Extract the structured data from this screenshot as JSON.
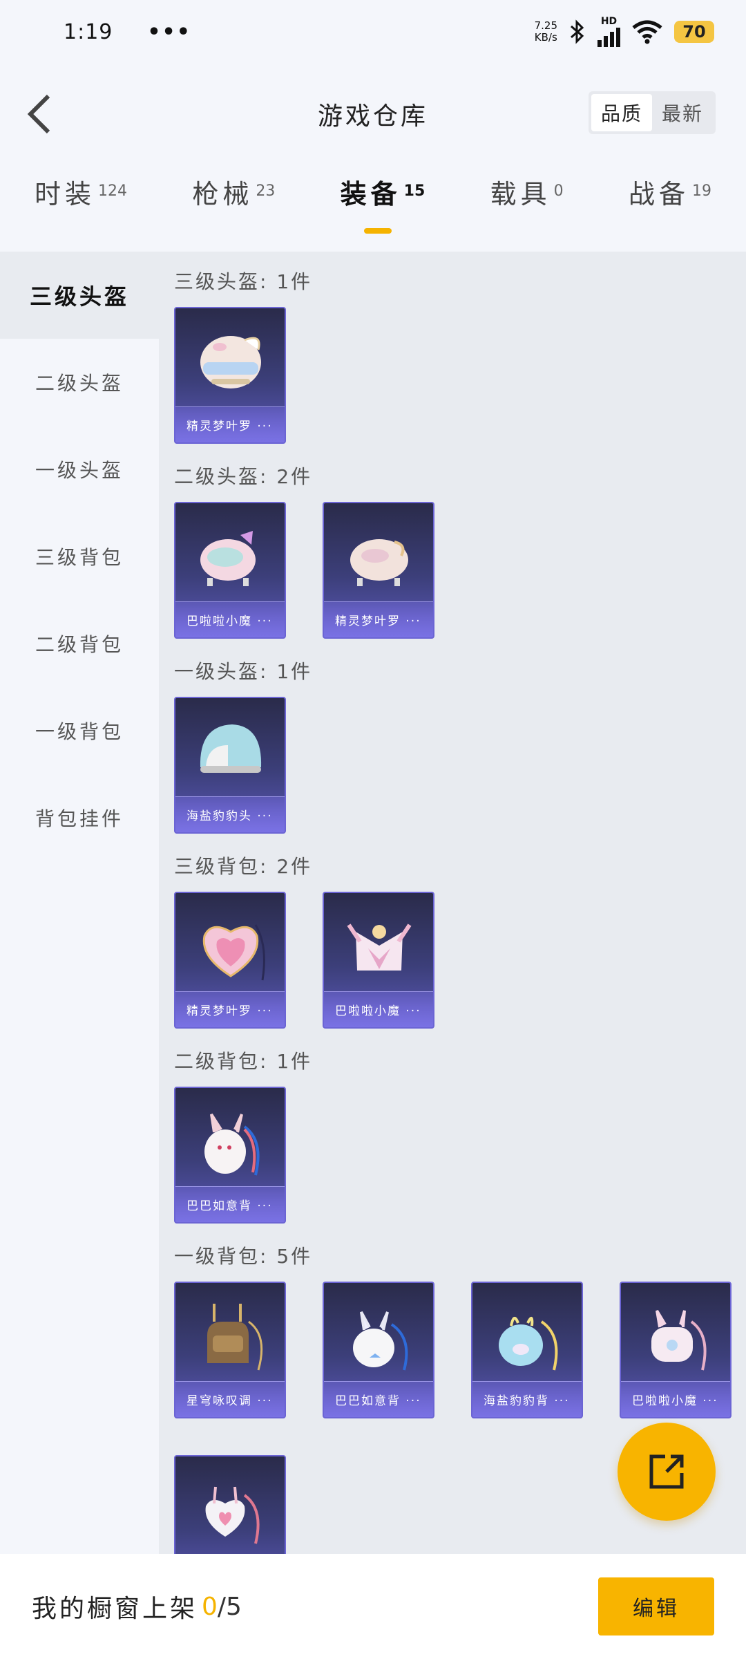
{
  "status_bar": {
    "time": "1:19",
    "dots": "•••",
    "net_speed_top": "7.25",
    "net_speed_bottom": "KB/s",
    "hd": "HD",
    "battery": "70"
  },
  "header": {
    "title": "游戏仓库",
    "sort_options": [
      "品质",
      "最新"
    ],
    "active_sort": "品质"
  },
  "tabs": [
    {
      "label": "时装",
      "count": "124"
    },
    {
      "label": "枪械",
      "count": "23"
    },
    {
      "label": "装备",
      "count": "15",
      "active": true
    },
    {
      "label": "载具",
      "count": "0"
    },
    {
      "label": "战备",
      "count": "19"
    }
  ],
  "sidebar": {
    "items": [
      "三级头盔",
      "二级头盔",
      "一级头盔",
      "三级背包",
      "二级背包",
      "一级背包",
      "背包挂件"
    ],
    "active": "三级头盔"
  },
  "sections": [
    {
      "title": "三级头盔: 1件",
      "items": [
        "精灵梦叶罗 ···"
      ]
    },
    {
      "title": "二级头盔: 2件",
      "items": [
        "巴啦啦小魔 ···",
        "精灵梦叶罗 ···"
      ]
    },
    {
      "title": "一级头盔: 1件",
      "items": [
        "海盐豹豹头 ···"
      ]
    },
    {
      "title": "三级背包: 2件",
      "items": [
        "精灵梦叶罗 ···",
        "巴啦啦小魔 ···"
      ]
    },
    {
      "title": "二级背包: 1件",
      "items": [
        "巴巴如意背 ···"
      ]
    },
    {
      "title": "一级背包: 5件",
      "items": [
        "星穹咏叹调 ···",
        "巴巴如意背 ···",
        "海盐豹豹背 ···",
        "巴啦啦小魔 ···",
        ""
      ]
    }
  ],
  "bottom_bar": {
    "label": "我的橱窗上架",
    "current": "0",
    "total": "/5",
    "edit_label": "编辑"
  },
  "colors": {
    "accent": "#f8b400",
    "card_border": "#6b64d4",
    "content_bg": "#e8ebf0"
  }
}
